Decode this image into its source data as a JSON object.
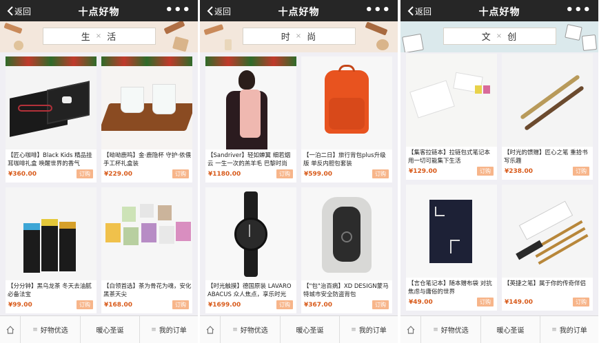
{
  "colors": {
    "titlebar": "#262626",
    "price": "#d85a1a",
    "buy_button": "#f7b58a",
    "background": "#f0eff4"
  },
  "screens": [
    {
      "back_label": "返回",
      "title": "十点好物",
      "more_label": "•••",
      "category": {
        "left": "生",
        "sep": "×",
        "right": "活"
      },
      "products": [
        {
          "desc": "【匠心咖啡】Black Kids 精品挂耳咖啡礼盒 唤醒世界的香气",
          "price": "¥360.00",
          "buy": "订购",
          "image": "black-gift-box"
        },
        {
          "desc": "【呦呦鹿鸣】金·鹿隐杯 守护·依偎 手工杯礼盒装",
          "price": "¥229.00",
          "buy": "订购",
          "image": "white-cups-on-tray"
        },
        {
          "desc": "【分分钟】黑乌龙茶 冬天去油腻必备法宝",
          "price": "¥99.00",
          "buy": "订购",
          "image": "tea-boxes"
        },
        {
          "desc": "【白领首选】茶为骨花为魂，安化黑茶天尖",
          "price": "¥168.00",
          "buy": "订购",
          "image": "pastel-tea-boxes"
        }
      ],
      "tabs": {
        "home": "home",
        "t1": "好物优选",
        "t2": "暖心圣诞",
        "t3": "我的订单"
      }
    },
    {
      "back_label": "返回",
      "title": "十点好物",
      "more_label": "•••",
      "category": {
        "left": "时",
        "sep": "×",
        "right": "尚"
      },
      "products": [
        {
          "desc": "【Sandriver】轻如蝉翼 细若烟云 一生一次的羔羊毛 巴黎时尚",
          "price": "¥1180.00",
          "buy": "订购",
          "image": "woman-with-scarf"
        },
        {
          "desc": "【一泊二日】旅行背包plus升级版 单反内胆包套装",
          "price": "¥599.00",
          "buy": "订购",
          "image": "orange-backpack"
        },
        {
          "desc": "【时光触摸】德国原装 LAVARO ABACUS 众人焦点，享乐时光",
          "price": "¥1699.00",
          "buy": "订购",
          "image": "black-watch"
        },
        {
          "desc": "【\"包\"治百病】XD DESIGN蒙马特城市安全防盗背包",
          "price": "¥367.00",
          "buy": "订购",
          "image": "grey-backpack"
        }
      ],
      "tabs": {
        "home": "home",
        "t1": "好物优选",
        "t2": "暖心圣诞",
        "t3": "我的订单"
      }
    },
    {
      "back_label": "返回",
      "title": "十点好物",
      "more_label": "•••",
      "category": {
        "left": "文",
        "sep": "×",
        "right": "创"
      },
      "products": [
        {
          "desc": "【集客拉链本】拉链包式笔记本 用一切可能集下生活",
          "price": "¥129.00",
          "buy": "订购",
          "image": "white-notebook-set"
        },
        {
          "desc": "【时光的馈赠】匠心之笔 重拾书写乐趣",
          "price": "¥238.00",
          "buy": "订购",
          "image": "gold-pens"
        },
        {
          "desc": "【言仓笔记本】随本赠布袋 对抗焦虑与庸俗的世界",
          "price": "¥49.00",
          "buy": "订购",
          "image": "dark-notebook"
        },
        {
          "desc": "【英捷之笔】属于你的传奇伴侣",
          "price": "¥149.00",
          "buy": "订购",
          "image": "pen-set-box"
        }
      ],
      "tabs": {
        "home": "home",
        "t1": "好物优选",
        "t2": "暖心圣诞",
        "t3": "我的订单"
      }
    }
  ]
}
